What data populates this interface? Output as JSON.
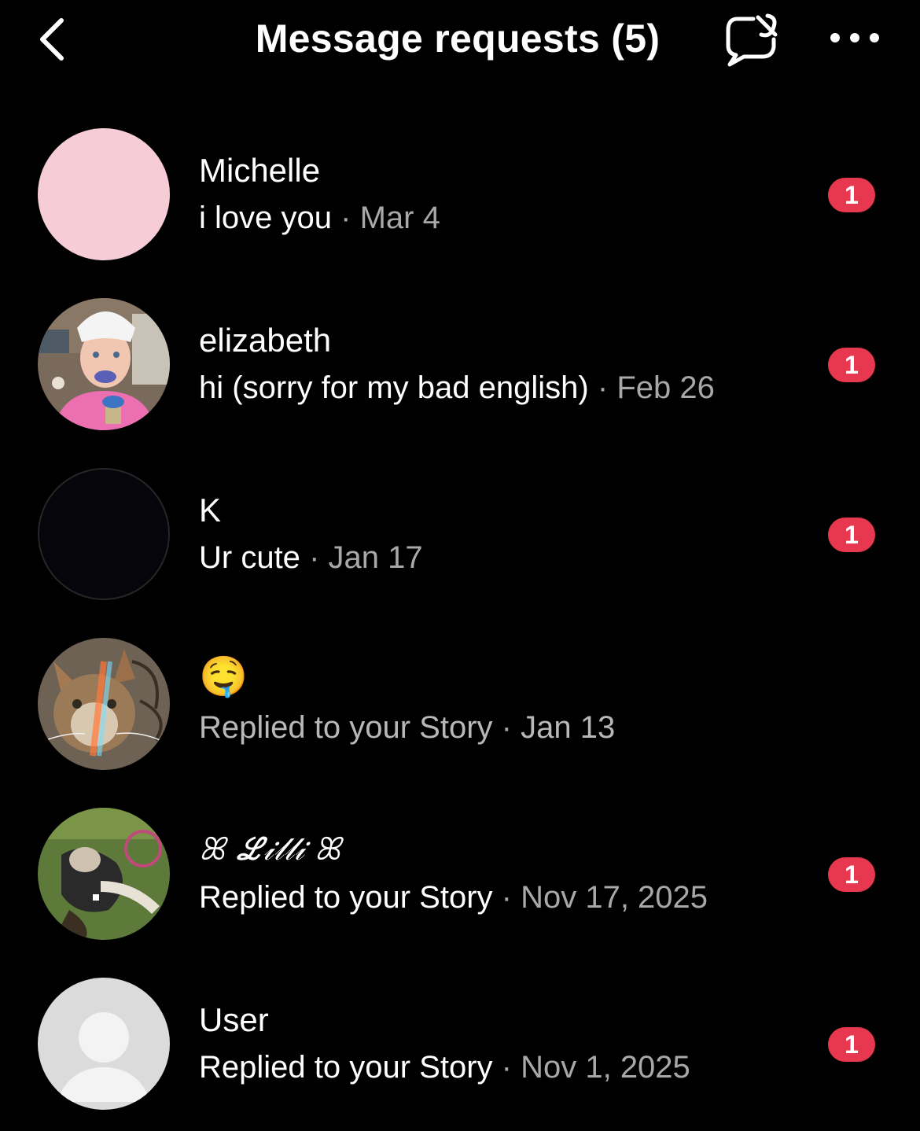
{
  "header": {
    "title": "Message requests (5)",
    "back_icon": "chevron-left-icon",
    "filter_icon": "message-filter-icon",
    "more_icon": "ellipsis-icon"
  },
  "requests": [
    {
      "name": "Michelle",
      "message": "i love you",
      "separator": "·",
      "date": "Mar 4",
      "unread": "1",
      "avatar": "pink-circle",
      "avatar_color": "#f6cdd6"
    },
    {
      "name": "elizabeth",
      "message": "hi (sorry for my bad english)",
      "separator": "·",
      "date": "Feb 26",
      "unread": "1",
      "avatar": "child-photo"
    },
    {
      "name": "K",
      "message": "Ur cute",
      "separator": "·",
      "date": "Jan 17",
      "unread": "1",
      "avatar": "dark-circle"
    },
    {
      "name": "🤤",
      "message": "Replied to your Story",
      "separator": "·",
      "date": "Jan 13",
      "unread": "",
      "avatar": "cat-photo"
    },
    {
      "name": "ꕤ ℒ𝒾𝓁𝓁𝒾 ꕤ",
      "message": "Replied to your Story",
      "separator": "·",
      "date": "Nov 17, 2025",
      "unread": "1",
      "avatar": "grass-photo"
    },
    {
      "name": "User",
      "message": "Replied to your Story",
      "separator": "·",
      "date": "Nov 1, 2025",
      "unread": "1",
      "avatar": "default-user"
    }
  ],
  "colors": {
    "badge": "#e8384f",
    "background": "#000000",
    "secondary_text": "#a8a8a8"
  }
}
